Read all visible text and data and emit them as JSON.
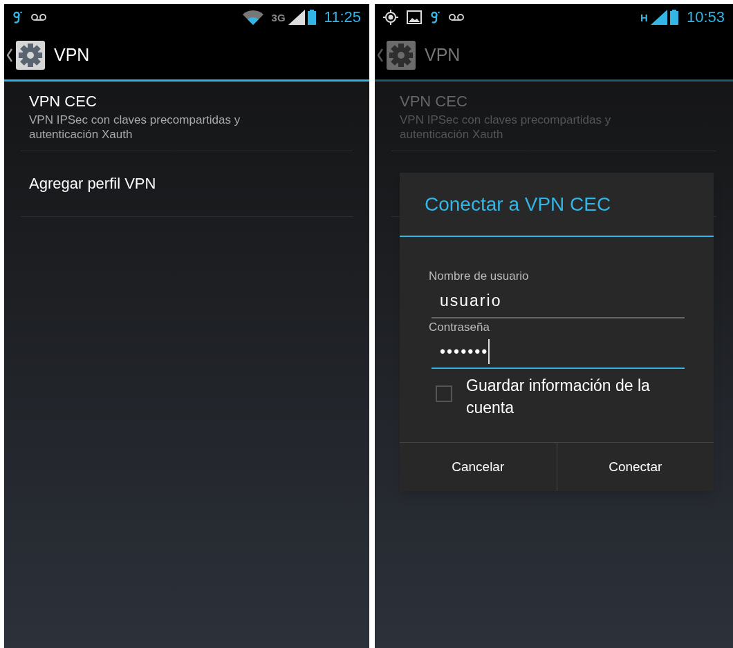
{
  "screens": [
    {
      "status_bar": {
        "kind": "wifi",
        "network": "3G",
        "time": "11:25"
      },
      "action_bar": {
        "title": "VPN"
      },
      "list": [
        {
          "title": "VPN CEC",
          "summary": "VPN IPSec con claves precompartidas y autenticación Xauth"
        },
        {
          "title": "Agregar perfil VPN"
        }
      ],
      "dimmed": false
    },
    {
      "status_bar": {
        "kind": "gps",
        "network": "H",
        "time": "10:53"
      },
      "action_bar": {
        "title": "VPN"
      },
      "list": [
        {
          "title": "VPN CEC",
          "summary": "VPN IPSec con claves precompartidas y autenticación Xauth"
        }
      ],
      "dimmed": true,
      "dialog": {
        "title": "Conectar a VPN CEC",
        "fields": [
          {
            "label": "Nombre de usuario",
            "value": "usuario",
            "focused": false
          },
          {
            "label": "Contraseña",
            "value": "•••••••",
            "focused": true
          }
        ],
        "checkbox": {
          "label": "Guardar información de la cuenta",
          "checked": false
        },
        "buttons": [
          "Cancelar",
          "Conectar"
        ]
      }
    }
  ]
}
